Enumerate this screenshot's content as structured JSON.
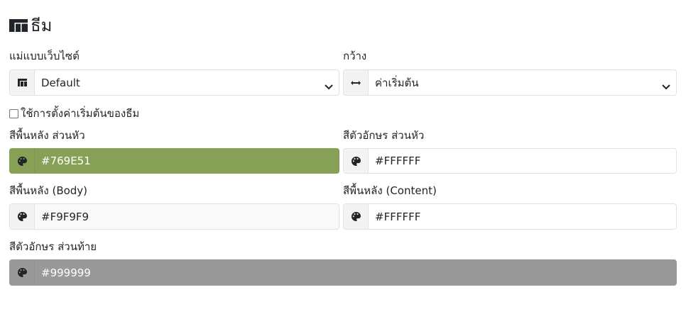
{
  "header": {
    "title": "ธีม",
    "icon": "layout-icon"
  },
  "template": {
    "label": "แม่แบบเว็บไซต์",
    "value": "Default",
    "icon": "layout-icon"
  },
  "width": {
    "label": "กว้าง",
    "value": "ค่าเริ่มต้น",
    "icon": "arrows-horizontal-icon"
  },
  "use_defaults": {
    "label": "ใช้การตั้งค่าเริ่มต้นของธีม",
    "checked": false
  },
  "header_bg": {
    "label": "สีพื้นหลัง ส่วนหัว",
    "value": "#769E51",
    "color": "#86A155",
    "icon": "palette-icon"
  },
  "header_text": {
    "label": "สีตัวอักษร ส่วนหัว",
    "value": "#FFFFFF",
    "color": "#FFFFFF",
    "icon": "palette-icon"
  },
  "body_bg": {
    "label": "สีพื้นหลัง (Body)",
    "value": "#F9F9F9",
    "color": "#F9F9F9",
    "icon": "palette-icon"
  },
  "content_bg": {
    "label": "สีพื้นหลัง (Content)",
    "value": "#FFFFFF",
    "color": "#FFFFFF",
    "icon": "palette-icon"
  },
  "footer_text": {
    "label": "สีตัวอักษร ส่วนท้าย",
    "value": "#999999",
    "color": "#999999",
    "icon": "palette-icon"
  }
}
